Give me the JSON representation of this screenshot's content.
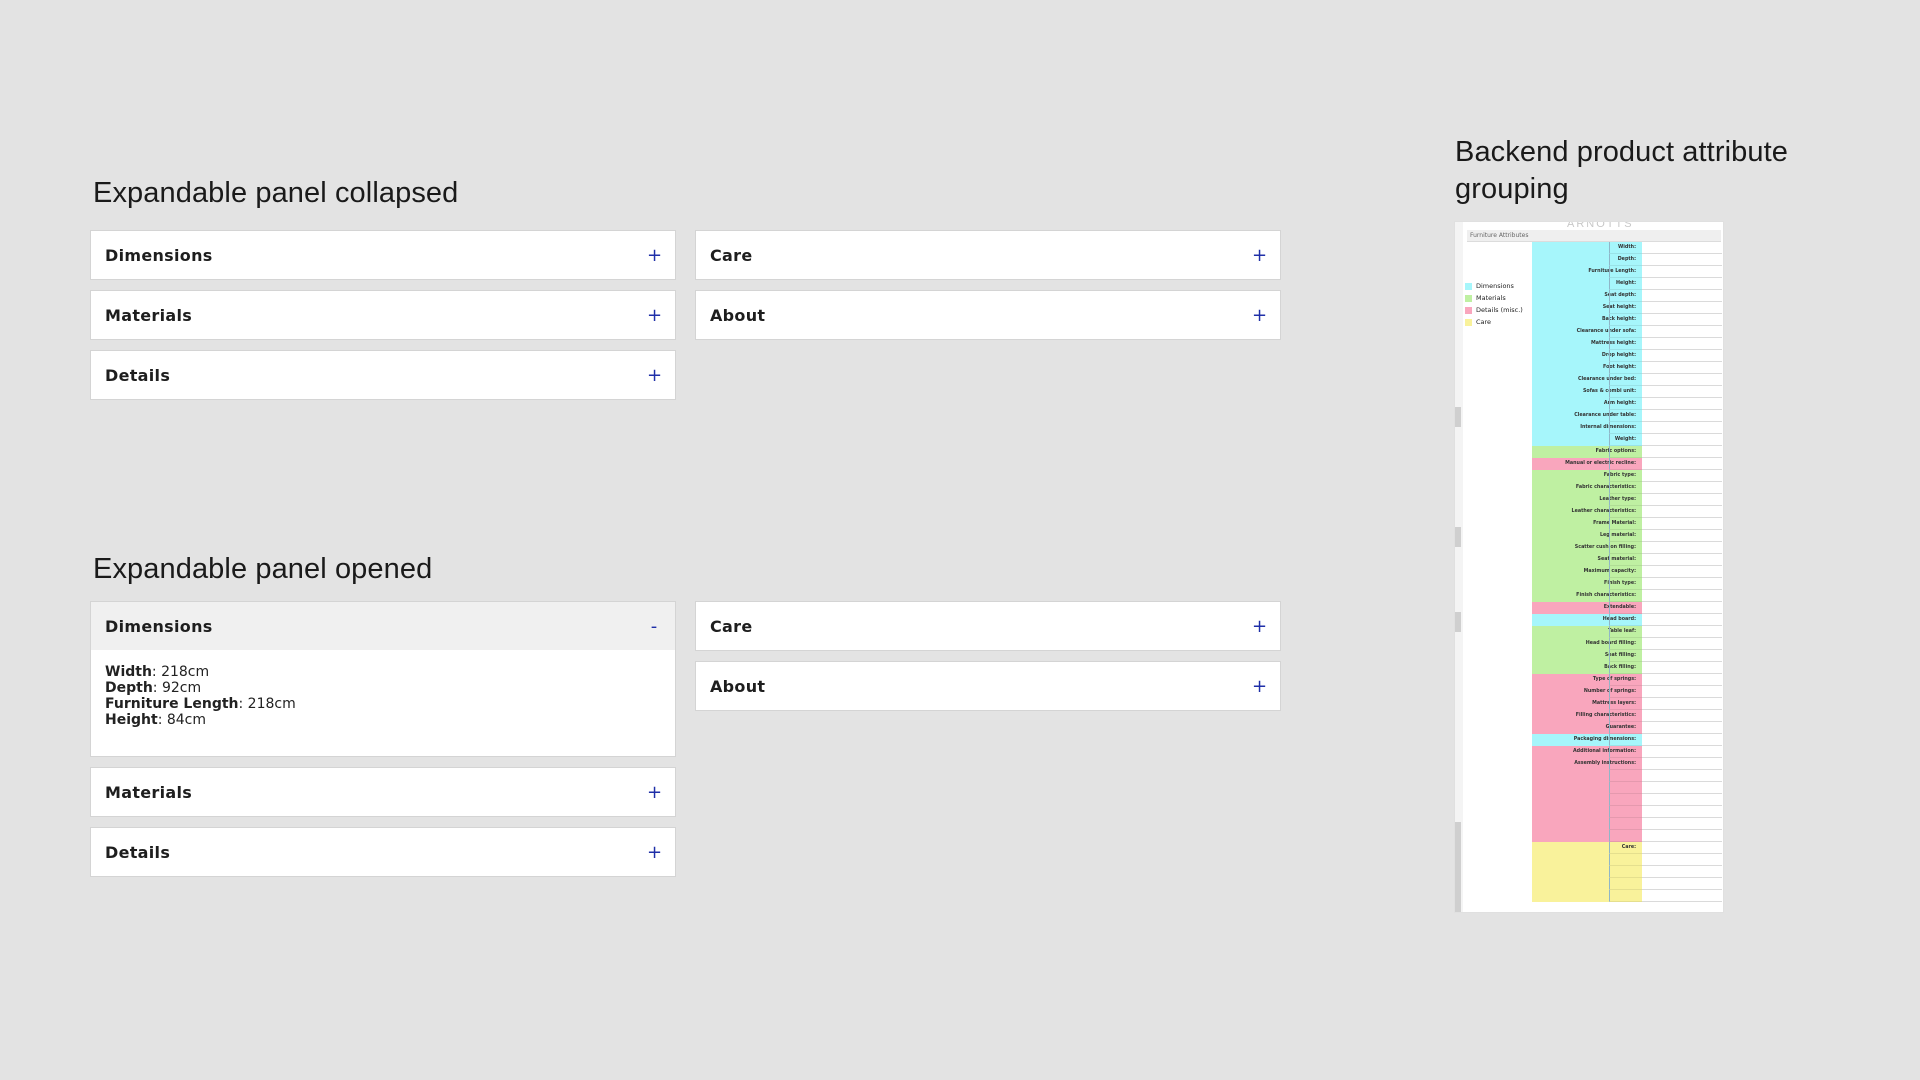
{
  "collapsed_section": {
    "title": "Expandable panel collapsed",
    "left": [
      {
        "label": "Dimensions",
        "toggle": "+"
      },
      {
        "label": "Materials",
        "toggle": "+"
      },
      {
        "label": "Details",
        "toggle": "+"
      }
    ],
    "right": [
      {
        "label": "Care",
        "toggle": "+"
      },
      {
        "label": "About",
        "toggle": "+"
      }
    ]
  },
  "opened_section": {
    "title": "Expandable panel opened",
    "open_panel": {
      "label": "Dimensions",
      "toggle": "-",
      "attributes": [
        {
          "name": "Width",
          "value": ": 218cm"
        },
        {
          "name": "Depth",
          "value": ": 92cm"
        },
        {
          "name": "Furniture Length",
          "value": ": 218cm"
        },
        {
          "name": "Height",
          "value": ": 84cm"
        }
      ]
    },
    "left_rest": [
      {
        "label": "Materials",
        "toggle": "+"
      },
      {
        "label": "Details",
        "toggle": "+"
      }
    ],
    "right": [
      {
        "label": "Care",
        "toggle": "+"
      },
      {
        "label": "About",
        "toggle": "+"
      }
    ]
  },
  "backend": {
    "title": "Backend product attribute grouping",
    "image": {
      "header_text": "Furniture Attributes",
      "logo_text": "ARNOTTS",
      "legend": [
        {
          "label": "Dimensions",
          "color": "#a6f6fb"
        },
        {
          "label": "Materials",
          "color": "#bff0a2"
        },
        {
          "label": "Details (misc.)",
          "color": "#f9a6bd"
        },
        {
          "label": "Care",
          "color": "#f9f29b"
        }
      ],
      "rows": [
        {
          "label": "Width:",
          "group": "dimensions"
        },
        {
          "label": "Depth:",
          "group": "dimensions"
        },
        {
          "label": "Furniture Length:",
          "group": "dimensions"
        },
        {
          "label": "Height:",
          "group": "dimensions"
        },
        {
          "label": "Seat depth:",
          "group": "dimensions"
        },
        {
          "label": "Seat height:",
          "group": "dimensions"
        },
        {
          "label": "Back height:",
          "group": "dimensions"
        },
        {
          "label": "Clearance under sofa:",
          "group": "dimensions"
        },
        {
          "label": "Mattress height:",
          "group": "dimensions"
        },
        {
          "label": "Drop height:",
          "group": "dimensions"
        },
        {
          "label": "Foot height:",
          "group": "dimensions"
        },
        {
          "label": "Clearance under bed:",
          "group": "dimensions"
        },
        {
          "label": "Sofas & combi unit:",
          "group": "dimensions"
        },
        {
          "label": "Arm height:",
          "group": "dimensions"
        },
        {
          "label": "Clearance under table:",
          "group": "dimensions"
        },
        {
          "label": "Internal dimensions:",
          "group": "dimensions"
        },
        {
          "label": "Weight:",
          "group": "dimensions"
        },
        {
          "label": "Fabric options:",
          "group": "materials"
        },
        {
          "label": "Manual or electric recline:",
          "group": "details"
        },
        {
          "label": "Fabric type:",
          "group": "materials"
        },
        {
          "label": "Fabric characteristics:",
          "group": "materials"
        },
        {
          "label": "Leather type:",
          "group": "materials"
        },
        {
          "label": "Leather characteristics:",
          "group": "materials"
        },
        {
          "label": "Frame Material:",
          "group": "materials"
        },
        {
          "label": "Leg material:",
          "group": "materials"
        },
        {
          "label": "Scatter cushion filling:",
          "group": "materials"
        },
        {
          "label": "Seat material:",
          "group": "materials"
        },
        {
          "label": "Maximum capacity:",
          "group": "materials"
        },
        {
          "label": "Finish type:",
          "group": "materials"
        },
        {
          "label": "Finish characteristics:",
          "group": "materials"
        },
        {
          "label": "Extendable:",
          "group": "details"
        },
        {
          "label": "Head board:",
          "group": "dimensions"
        },
        {
          "label": "Table leaf:",
          "group": "materials"
        },
        {
          "label": "Head board filling:",
          "group": "materials"
        },
        {
          "label": "Seat filling:",
          "group": "materials"
        },
        {
          "label": "Back filling:",
          "group": "materials"
        },
        {
          "label": "Type of springs:",
          "group": "details"
        },
        {
          "label": "Number of springs:",
          "group": "details"
        },
        {
          "label": "Mattress layers:",
          "group": "details"
        },
        {
          "label": "Filling characteristics:",
          "group": "details"
        },
        {
          "label": "Guarantee:",
          "group": "details"
        },
        {
          "label": "Packaging dimensions:",
          "group": "dimensions"
        },
        {
          "label": "Additional information:",
          "group": "details"
        },
        {
          "label": "Assembly instructions:",
          "group": "details"
        },
        {
          "label": "",
          "group": "details"
        },
        {
          "label": "",
          "group": "details"
        },
        {
          "label": "",
          "group": "details"
        },
        {
          "label": "",
          "group": "details"
        },
        {
          "label": "",
          "group": "details"
        },
        {
          "label": "",
          "group": "details"
        },
        {
          "label": "Care:",
          "group": "care"
        },
        {
          "label": "",
          "group": "care"
        },
        {
          "label": "",
          "group": "care"
        },
        {
          "label": "",
          "group": "care"
        },
        {
          "label": "",
          "group": "care"
        }
      ],
      "group_colors": {
        "dimensions": "#a6f6fb",
        "materials": "#bff0a2",
        "details": "#f9a6bd",
        "care": "#f9f29b"
      }
    }
  }
}
